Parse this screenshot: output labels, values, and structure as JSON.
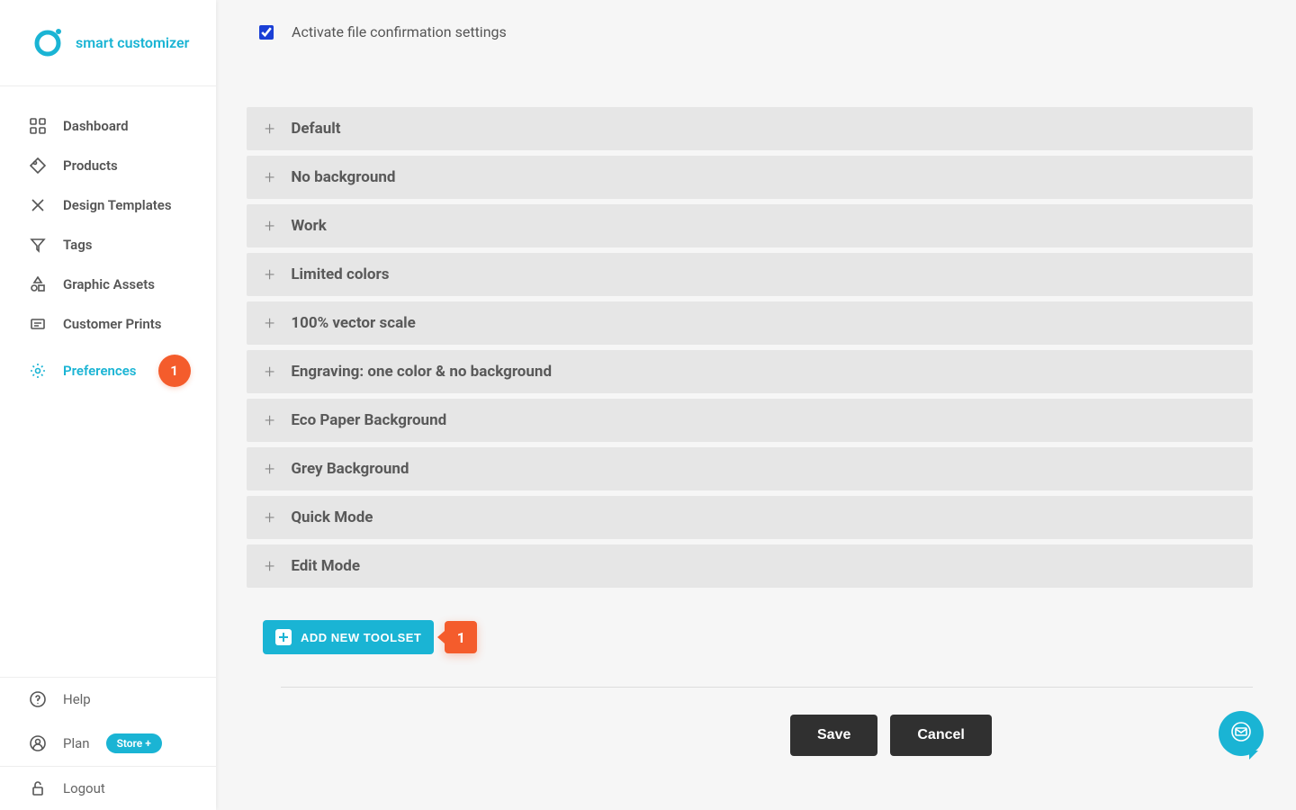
{
  "brand": {
    "name": "smart customizer"
  },
  "sidebar": {
    "items": [
      {
        "label": "Dashboard"
      },
      {
        "label": "Products"
      },
      {
        "label": "Design Templates"
      },
      {
        "label": "Tags"
      },
      {
        "label": "Graphic Assets"
      },
      {
        "label": "Customer Prints"
      },
      {
        "label": "Preferences",
        "badge": "1"
      }
    ]
  },
  "footer": {
    "help": "Help",
    "plan_label": "Plan",
    "plan_badge": "Store +",
    "logout": "Logout"
  },
  "checkbox": {
    "label": "Activate file confirmation settings",
    "checked": true
  },
  "toolsets": [
    {
      "label": "Default"
    },
    {
      "label": "No background"
    },
    {
      "label": "Work"
    },
    {
      "label": "Limited colors"
    },
    {
      "label": "100% vector scale"
    },
    {
      "label": "Engraving: one color & no background"
    },
    {
      "label": "Eco Paper Background"
    },
    {
      "label": "Grey Background"
    },
    {
      "label": "Quick Mode"
    },
    {
      "label": "Edit Mode"
    }
  ],
  "add_button": {
    "label": "ADD NEW TOOLSET",
    "callout": "1"
  },
  "actions": {
    "save": "Save",
    "cancel": "Cancel"
  }
}
